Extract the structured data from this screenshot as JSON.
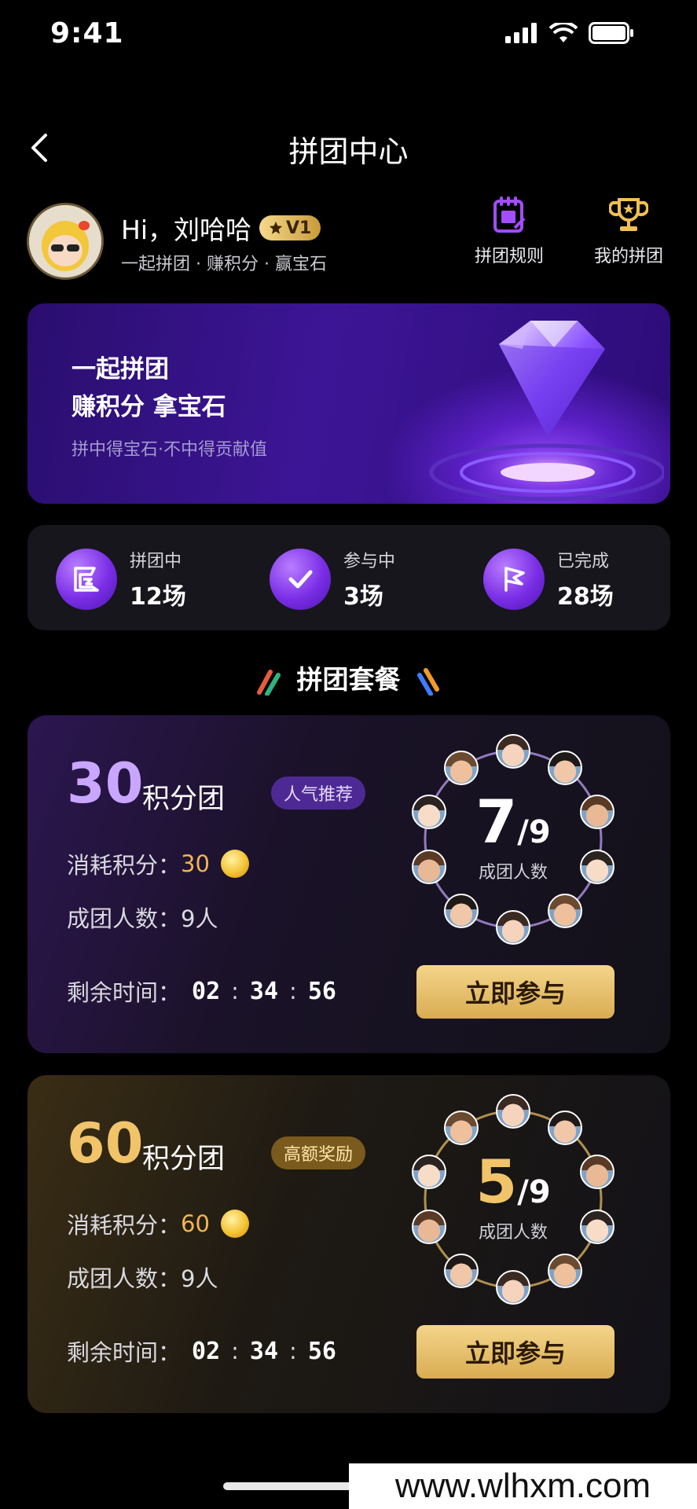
{
  "status_bar": {
    "time": "9:41"
  },
  "nav": {
    "title": "拼团中心"
  },
  "profile": {
    "greeting": "Hi，刘哈哈",
    "level": "V1",
    "slogan": "一起拼团 · 赚积分 · 赢宝石"
  },
  "quick_links": [
    {
      "label": "拼团规则",
      "icon": "rules-document-icon"
    },
    {
      "label": "我的拼团",
      "icon": "trophy-icon"
    }
  ],
  "banner": {
    "line1": "一起拼团",
    "line2": "赚积分 拿宝石",
    "sub": "拼中得宝石·不中得贡献值"
  },
  "stats": [
    {
      "label": "拼团中",
      "value": "12场",
      "icon": "group-icon"
    },
    {
      "label": "参与中",
      "value": "3场",
      "icon": "check-icon"
    },
    {
      "label": "已完成",
      "value": "28场",
      "icon": "flag-icon"
    }
  ],
  "section_title": "拼团套餐",
  "packages": [
    {
      "points": "30",
      "name": "积分团",
      "tag": "人气推荐",
      "cost_label": "消耗积分：",
      "cost_value": "30",
      "members_label": "成团人数：",
      "members_value": "9人",
      "timer_label": "剩余时间：",
      "timer": [
        "02",
        "34",
        "56"
      ],
      "joined": "7",
      "total": "/9",
      "ring_label": "成团人数",
      "button": "立即参与",
      "accent": "#c9a6ff"
    },
    {
      "points": "60",
      "name": "积分团",
      "tag": "高额奖励",
      "cost_label": "消耗积分：",
      "cost_value": "60",
      "members_label": "成团人数：",
      "members_value": "9人",
      "timer_label": "剩余时间：",
      "timer": [
        "02",
        "34",
        "56"
      ],
      "joined": "5",
      "total": "/9",
      "ring_label": "成团人数",
      "button": "立即参与",
      "accent": "#f1c46a"
    }
  ],
  "watermark": "www.wlhxm.com"
}
